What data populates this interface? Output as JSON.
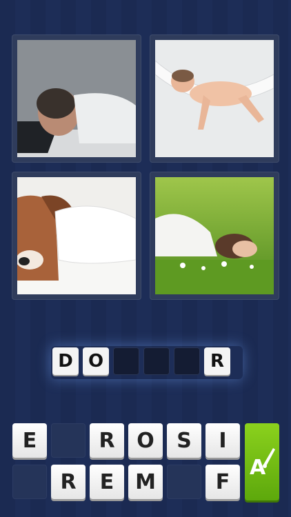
{
  "puzzle": {
    "images": [
      {
        "name": "man-asleep-on-laptop"
      },
      {
        "name": "baby-in-hammock"
      },
      {
        "name": "dog-sleeping-in-bed"
      },
      {
        "name": "woman-sleeping-in-grass"
      }
    ]
  },
  "answer": {
    "slots": [
      "D",
      "O",
      "",
      "",
      "",
      "R"
    ]
  },
  "letters": {
    "row1": [
      "E",
      "",
      "R",
      "O",
      "S",
      "I"
    ],
    "row2": [
      "",
      "R",
      "E",
      "M",
      "",
      "F"
    ]
  },
  "hint": {
    "icon": "brush-hint-icon",
    "label": "A"
  },
  "colors": {
    "background": "#1b2a52",
    "hint_green": "#7cc314"
  }
}
